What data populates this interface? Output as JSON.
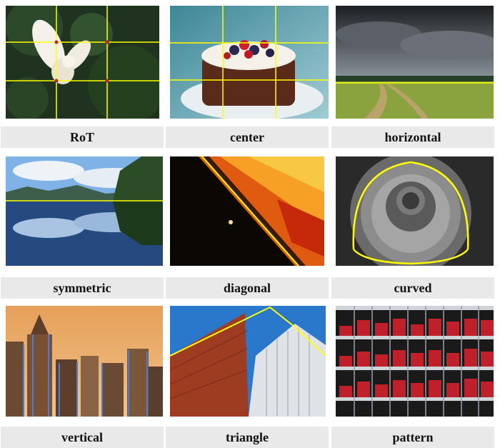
{
  "panels": [
    {
      "label": "RoT",
      "guide_color": "#ffff00"
    },
    {
      "label": "center",
      "guide_color": "#ffff00"
    },
    {
      "label": "horizontal",
      "guide_color": "#ffff00"
    },
    {
      "label": "symmetric",
      "guide_color": "#ffff00"
    },
    {
      "label": "diagonal",
      "guide_color": "#ffff00"
    },
    {
      "label": "curved",
      "guide_color": "#ffff00"
    },
    {
      "label": "vertical",
      "guide_color": "#4a7fd0"
    },
    {
      "label": "triangle",
      "guide_color": "#ffff00"
    },
    {
      "label": "pattern",
      "guide_color": "#ffff00"
    }
  ],
  "label_bar_color": "#e9e9e9"
}
